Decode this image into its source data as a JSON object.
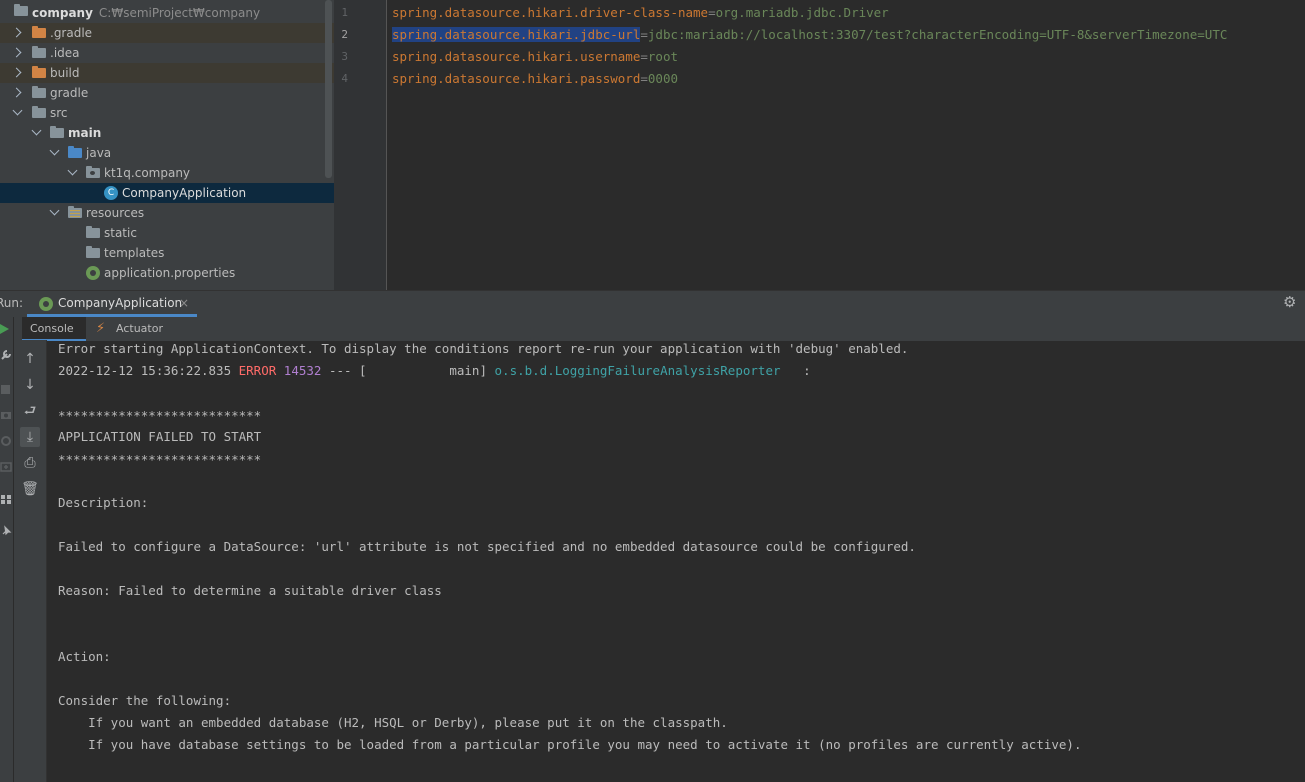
{
  "project": {
    "root": {
      "label": "company",
      "path": "C:₩semiProject₩company"
    },
    "items": [
      {
        "label": ".gradle"
      },
      {
        "label": ".idea"
      },
      {
        "label": "build"
      },
      {
        "label": "gradle"
      },
      {
        "label": "src"
      },
      {
        "label": "main"
      },
      {
        "label": "java"
      },
      {
        "label": "kt1q.company"
      },
      {
        "label": "CompanyApplication"
      },
      {
        "label": "resources"
      },
      {
        "label": "static"
      },
      {
        "label": "templates"
      },
      {
        "label": "application.properties"
      }
    ]
  },
  "editor": {
    "line_numbers": [
      "1",
      "2",
      "3",
      "4"
    ],
    "lines": [
      {
        "key": "spring.datasource.hikari.driver-class-name",
        "eq": "=",
        "value": "org.mariadb.jdbc.Driver"
      },
      {
        "key": "spring.datasource.hikari.jdbc-url",
        "eq": "=",
        "value": "jdbc:mariadb://localhost:3307/test?characterEncoding=UTF-8&serverTimezone=UTC"
      },
      {
        "key": "spring.datasource.hikari.username",
        "eq": "=",
        "value": "root"
      },
      {
        "key": "spring.datasource.hikari.password",
        "eq": "=",
        "value": "0000"
      }
    ]
  },
  "run": {
    "label": "Run:",
    "tab_label": "CompanyApplication",
    "close_glyph": "×",
    "subtabs": {
      "console": "Console",
      "actuator": "Actuator"
    }
  },
  "console": {
    "line0": "Error starting ApplicationContext. To display the conditions report re-run your application with 'debug' enabled.",
    "log": {
      "timestamp": "2022-12-12 15:36:22.835 ",
      "level": "ERROR",
      "pid": " 14532",
      "thread": " --- [           main] ",
      "logger": "o.s.b.d.LoggingFailureAnalysisReporter",
      "tail": "   :"
    },
    "lines": [
      "***************************",
      "APPLICATION FAILED TO START",
      "***************************",
      "Description:",
      "Failed to configure a DataSource: 'url' attribute is not specified and no embedded datasource could be configured.",
      "Reason: Failed to determine a suitable driver class",
      "Action:",
      "Consider the following:",
      "    If you want an embedded database (H2, HSQL or Derby), please put it on the classpath.",
      "    If you have database settings to be loaded from a particular profile you may need to activate it (no profiles are currently active)."
    ]
  }
}
